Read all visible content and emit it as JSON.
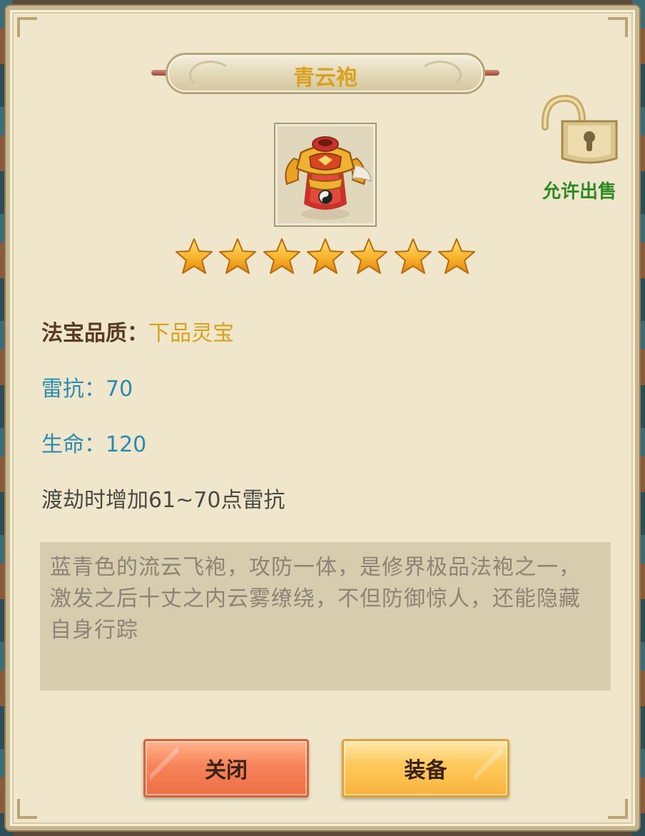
{
  "dialog": {
    "title": "青云袍",
    "sell_status": "允许出售",
    "star_count": 7,
    "stats": {
      "quality_label": "法宝品质：",
      "quality_value": "下品灵宝",
      "thunder_resist": "雷抗：70",
      "life": "生命：120",
      "effect": "渡劫时增加61~70点雷抗"
    },
    "description": "蓝青色的流云飞袍，攻防一体，是修界极品法袍之一，激发之后十丈之内云雾缭绕，不但防御惊人，还能隐藏自身行踪",
    "buttons": {
      "close": "关闭",
      "equip": "装备"
    }
  },
  "icons": {
    "item": "robe-armor-icon",
    "lock": "unlocked-padlock-icon",
    "star": "star-icon"
  },
  "colors": {
    "title": "#d9a21e",
    "quality_value": "#d9a21e",
    "stat_blue": "#2a8ab0",
    "sell_green": "#2e8a22",
    "close_button": "#f7835a",
    "equip_button": "#ffc85a"
  }
}
